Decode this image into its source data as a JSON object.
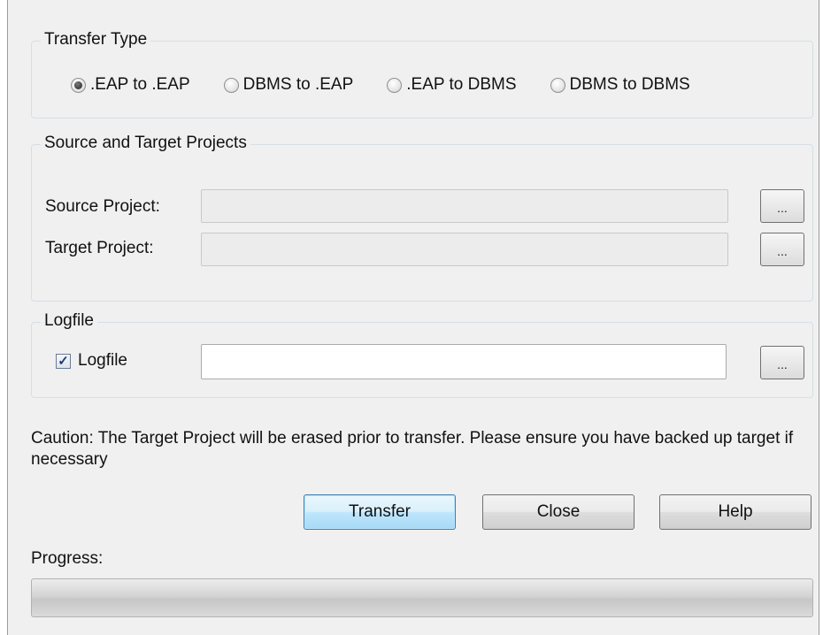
{
  "transfer_type": {
    "title": "Transfer Type",
    "options": [
      {
        "label": ".EAP to .EAP",
        "checked": true
      },
      {
        "label": "DBMS to .EAP",
        "checked": false
      },
      {
        "label": ".EAP to DBMS",
        "checked": false
      },
      {
        "label": "DBMS to DBMS",
        "checked": false
      }
    ]
  },
  "projects": {
    "title": "Source and Target Projects",
    "source_label": "Source Project:",
    "source_value": "",
    "target_label": "Target Project:",
    "target_value": "",
    "browse_label": "..."
  },
  "logfile": {
    "title": "Logfile",
    "checkbox_label": "Logfile",
    "checked": true,
    "value": "",
    "browse_label": "..."
  },
  "caution": "Caution: The Target Project will be erased prior to transfer. Please ensure you have backed up target if necessary",
  "buttons": {
    "transfer": "Transfer",
    "close": "Close",
    "help": "Help"
  },
  "progress": {
    "label": "Progress:",
    "value": 0
  }
}
